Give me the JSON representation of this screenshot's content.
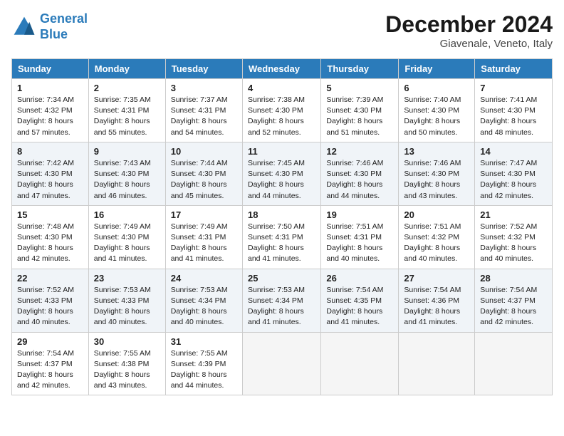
{
  "header": {
    "logo_line1": "General",
    "logo_line2": "Blue",
    "month": "December 2024",
    "location": "Giavenale, Veneto, Italy"
  },
  "weekdays": [
    "Sunday",
    "Monday",
    "Tuesday",
    "Wednesday",
    "Thursday",
    "Friday",
    "Saturday"
  ],
  "weeks": [
    [
      {
        "day": "1",
        "lines": [
          "Sunrise: 7:34 AM",
          "Sunset: 4:32 PM",
          "Daylight: 8 hours",
          "and 57 minutes."
        ]
      },
      {
        "day": "2",
        "lines": [
          "Sunrise: 7:35 AM",
          "Sunset: 4:31 PM",
          "Daylight: 8 hours",
          "and 55 minutes."
        ]
      },
      {
        "day": "3",
        "lines": [
          "Sunrise: 7:37 AM",
          "Sunset: 4:31 PM",
          "Daylight: 8 hours",
          "and 54 minutes."
        ]
      },
      {
        "day": "4",
        "lines": [
          "Sunrise: 7:38 AM",
          "Sunset: 4:30 PM",
          "Daylight: 8 hours",
          "and 52 minutes."
        ]
      },
      {
        "day": "5",
        "lines": [
          "Sunrise: 7:39 AM",
          "Sunset: 4:30 PM",
          "Daylight: 8 hours",
          "and 51 minutes."
        ]
      },
      {
        "day": "6",
        "lines": [
          "Sunrise: 7:40 AM",
          "Sunset: 4:30 PM",
          "Daylight: 8 hours",
          "and 50 minutes."
        ]
      },
      {
        "day": "7",
        "lines": [
          "Sunrise: 7:41 AM",
          "Sunset: 4:30 PM",
          "Daylight: 8 hours",
          "and 48 minutes."
        ]
      }
    ],
    [
      {
        "day": "8",
        "lines": [
          "Sunrise: 7:42 AM",
          "Sunset: 4:30 PM",
          "Daylight: 8 hours",
          "and 47 minutes."
        ]
      },
      {
        "day": "9",
        "lines": [
          "Sunrise: 7:43 AM",
          "Sunset: 4:30 PM",
          "Daylight: 8 hours",
          "and 46 minutes."
        ]
      },
      {
        "day": "10",
        "lines": [
          "Sunrise: 7:44 AM",
          "Sunset: 4:30 PM",
          "Daylight: 8 hours",
          "and 45 minutes."
        ]
      },
      {
        "day": "11",
        "lines": [
          "Sunrise: 7:45 AM",
          "Sunset: 4:30 PM",
          "Daylight: 8 hours",
          "and 44 minutes."
        ]
      },
      {
        "day": "12",
        "lines": [
          "Sunrise: 7:46 AM",
          "Sunset: 4:30 PM",
          "Daylight: 8 hours",
          "and 44 minutes."
        ]
      },
      {
        "day": "13",
        "lines": [
          "Sunrise: 7:46 AM",
          "Sunset: 4:30 PM",
          "Daylight: 8 hours",
          "and 43 minutes."
        ]
      },
      {
        "day": "14",
        "lines": [
          "Sunrise: 7:47 AM",
          "Sunset: 4:30 PM",
          "Daylight: 8 hours",
          "and 42 minutes."
        ]
      }
    ],
    [
      {
        "day": "15",
        "lines": [
          "Sunrise: 7:48 AM",
          "Sunset: 4:30 PM",
          "Daylight: 8 hours",
          "and 42 minutes."
        ]
      },
      {
        "day": "16",
        "lines": [
          "Sunrise: 7:49 AM",
          "Sunset: 4:30 PM",
          "Daylight: 8 hours",
          "and 41 minutes."
        ]
      },
      {
        "day": "17",
        "lines": [
          "Sunrise: 7:49 AM",
          "Sunset: 4:31 PM",
          "Daylight: 8 hours",
          "and 41 minutes."
        ]
      },
      {
        "day": "18",
        "lines": [
          "Sunrise: 7:50 AM",
          "Sunset: 4:31 PM",
          "Daylight: 8 hours",
          "and 41 minutes."
        ]
      },
      {
        "day": "19",
        "lines": [
          "Sunrise: 7:51 AM",
          "Sunset: 4:31 PM",
          "Daylight: 8 hours",
          "and 40 minutes."
        ]
      },
      {
        "day": "20",
        "lines": [
          "Sunrise: 7:51 AM",
          "Sunset: 4:32 PM",
          "Daylight: 8 hours",
          "and 40 minutes."
        ]
      },
      {
        "day": "21",
        "lines": [
          "Sunrise: 7:52 AM",
          "Sunset: 4:32 PM",
          "Daylight: 8 hours",
          "and 40 minutes."
        ]
      }
    ],
    [
      {
        "day": "22",
        "lines": [
          "Sunrise: 7:52 AM",
          "Sunset: 4:33 PM",
          "Daylight: 8 hours",
          "and 40 minutes."
        ]
      },
      {
        "day": "23",
        "lines": [
          "Sunrise: 7:53 AM",
          "Sunset: 4:33 PM",
          "Daylight: 8 hours",
          "and 40 minutes."
        ]
      },
      {
        "day": "24",
        "lines": [
          "Sunrise: 7:53 AM",
          "Sunset: 4:34 PM",
          "Daylight: 8 hours",
          "and 40 minutes."
        ]
      },
      {
        "day": "25",
        "lines": [
          "Sunrise: 7:53 AM",
          "Sunset: 4:34 PM",
          "Daylight: 8 hours",
          "and 41 minutes."
        ]
      },
      {
        "day": "26",
        "lines": [
          "Sunrise: 7:54 AM",
          "Sunset: 4:35 PM",
          "Daylight: 8 hours",
          "and 41 minutes."
        ]
      },
      {
        "day": "27",
        "lines": [
          "Sunrise: 7:54 AM",
          "Sunset: 4:36 PM",
          "Daylight: 8 hours",
          "and 41 minutes."
        ]
      },
      {
        "day": "28",
        "lines": [
          "Sunrise: 7:54 AM",
          "Sunset: 4:37 PM",
          "Daylight: 8 hours",
          "and 42 minutes."
        ]
      }
    ],
    [
      {
        "day": "29",
        "lines": [
          "Sunrise: 7:54 AM",
          "Sunset: 4:37 PM",
          "Daylight: 8 hours",
          "and 42 minutes."
        ]
      },
      {
        "day": "30",
        "lines": [
          "Sunrise: 7:55 AM",
          "Sunset: 4:38 PM",
          "Daylight: 8 hours",
          "and 43 minutes."
        ]
      },
      {
        "day": "31",
        "lines": [
          "Sunrise: 7:55 AM",
          "Sunset: 4:39 PM",
          "Daylight: 8 hours",
          "and 44 minutes."
        ]
      },
      {
        "day": "",
        "lines": []
      },
      {
        "day": "",
        "lines": []
      },
      {
        "day": "",
        "lines": []
      },
      {
        "day": "",
        "lines": []
      }
    ]
  ]
}
